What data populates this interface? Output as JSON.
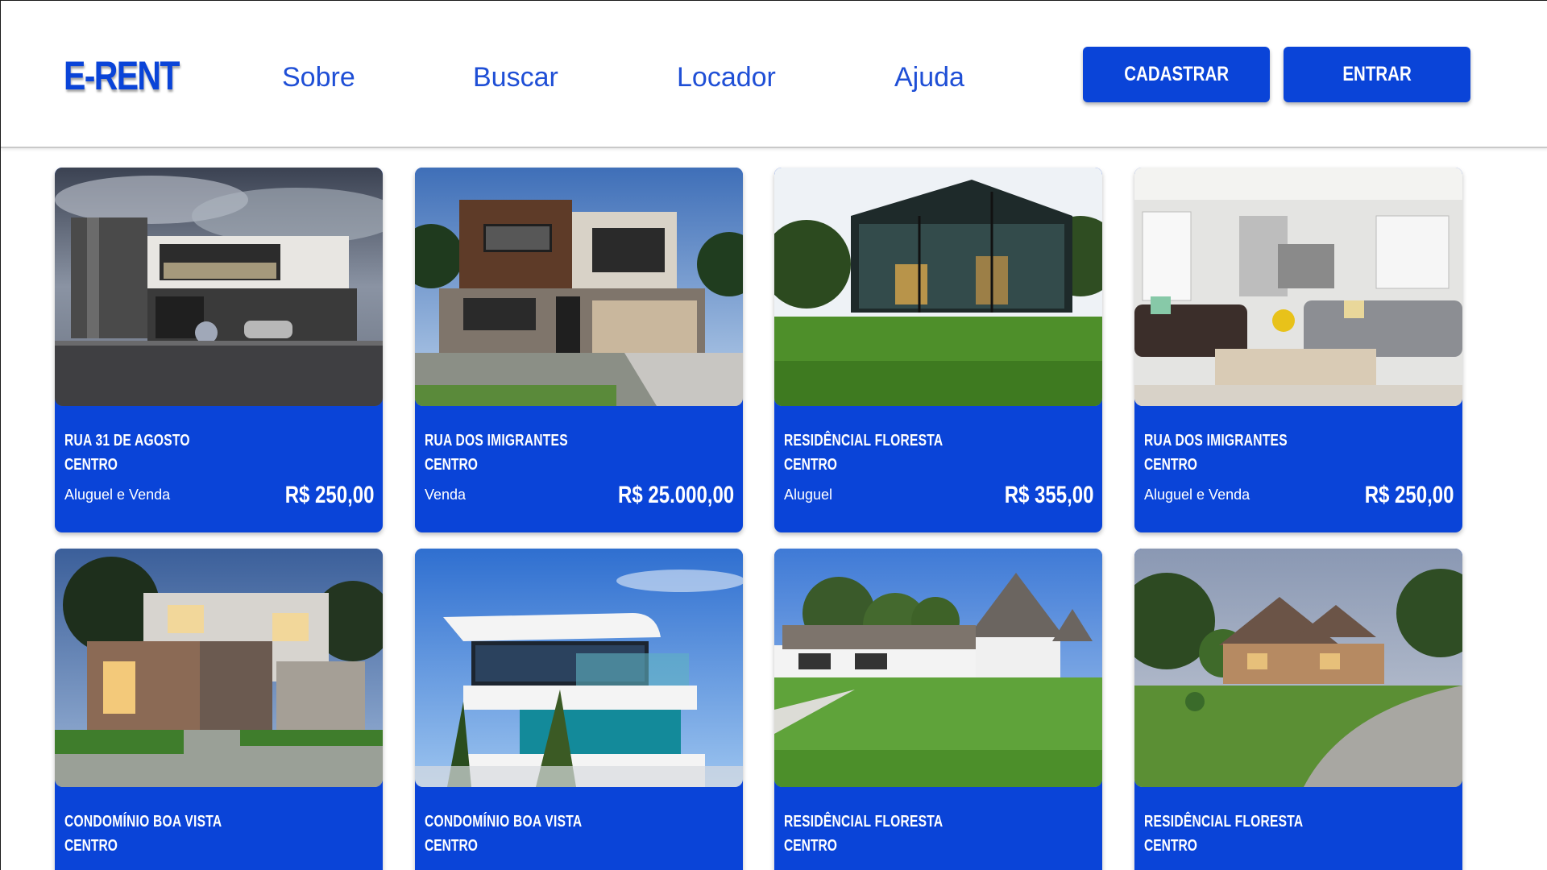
{
  "brand": {
    "logo": "E-RENT",
    "accent": "#0a44d8"
  },
  "nav": {
    "sobre": "Sobre",
    "buscar": "Buscar",
    "locador": "Locador",
    "ajuda": "Ajuda"
  },
  "actions": {
    "cadastrar": "CADASTRAR",
    "entrar": "ENTRAR"
  },
  "listings": [
    {
      "street": "RUA 31 DE AGOSTO",
      "district": "CENTRO",
      "type": "Aluguel e Venda",
      "price": "R$ 250,00",
      "image": "modern-house-dusk"
    },
    {
      "street": "RUA DOS IMIGRANTES",
      "district": "CENTRO",
      "type": "Venda",
      "price": "R$ 25.000,00",
      "image": "two-story-house-garage"
    },
    {
      "street": "RESIDÊNCIAL FLORESTA",
      "district": "CENTRO",
      "type": "Aluguel",
      "price": "R$ 355,00",
      "image": "glass-house-lawn"
    },
    {
      "street": "RUA DOS IMIGRANTES",
      "district": "CENTRO",
      "type": "Aluguel e Venda",
      "price": "R$ 250,00",
      "image": "living-room-interior"
    },
    {
      "street": "CONDOMÍNIO BOA VISTA",
      "district": "CENTRO",
      "type": "",
      "price": "",
      "image": "house-evening-lights"
    },
    {
      "street": "CONDOMÍNIO BOA VISTA",
      "district": "CENTRO",
      "type": "",
      "price": "",
      "image": "white-modern-building"
    },
    {
      "street": "RESIDÊNCIAL FLORESTA",
      "district": "CENTRO",
      "type": "",
      "price": "",
      "image": "white-house-lawn"
    },
    {
      "street": "RESIDÊNCIAL FLORESTA",
      "district": "CENTRO",
      "type": "",
      "price": "",
      "image": "stone-house-driveway"
    }
  ]
}
